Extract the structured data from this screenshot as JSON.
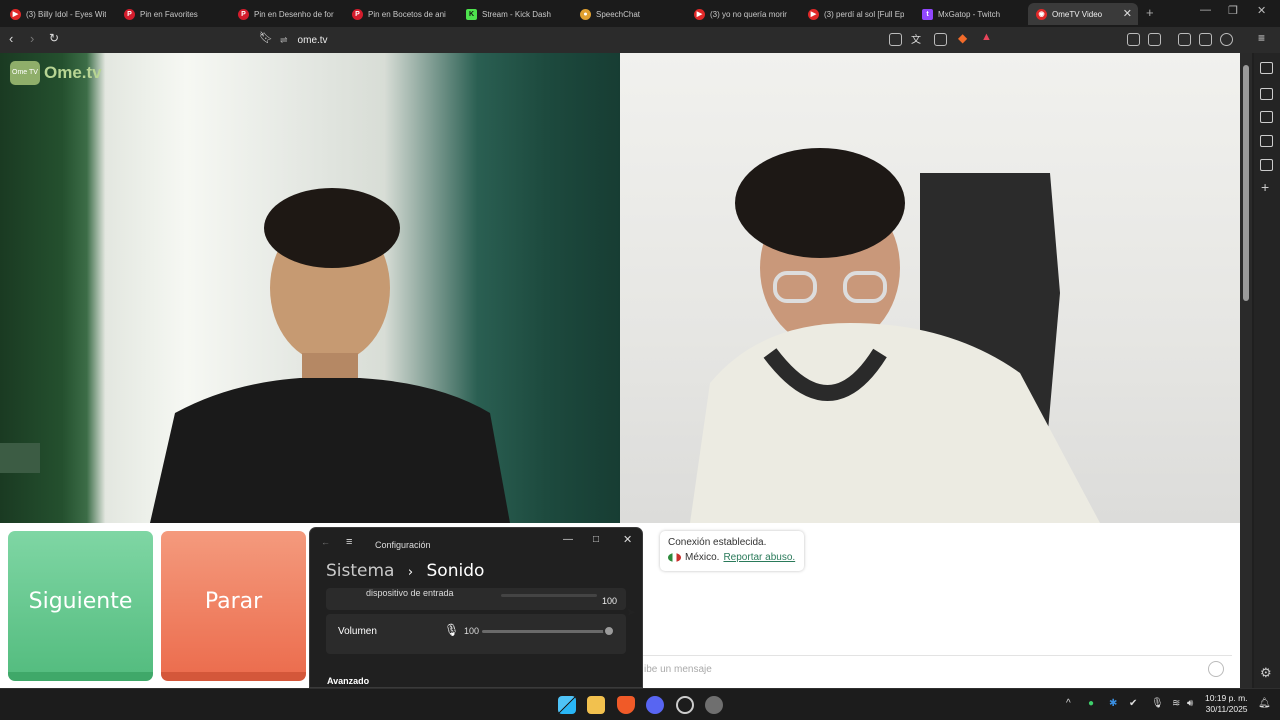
{
  "tabs": [
    {
      "title": "(3) Billy Idol - Eyes Wit",
      "icon": "youtube-icon",
      "color": "#e02828"
    },
    {
      "title": "Pin en Favorites",
      "icon": "pinterest-icon",
      "color": "#d41c2c"
    },
    {
      "title": "Pin en Desenho de for",
      "icon": "pinterest-icon",
      "color": "#d41c2c"
    },
    {
      "title": "Pin en Bocetos de ani",
      "icon": "pinterest-icon",
      "color": "#d41c2c"
    },
    {
      "title": "Stream - Kick Dash",
      "icon": "kick-icon",
      "color": "#4ee34e"
    },
    {
      "title": "SpeechChat",
      "icon": "speechchat-icon",
      "color": "#e0a030"
    },
    {
      "title": "(3) yo no quería morir",
      "icon": "youtube-icon",
      "color": "#e02828"
    },
    {
      "title": "(3) perdí al sol [Full Ep",
      "icon": "youtube-icon",
      "color": "#e02828"
    },
    {
      "title": "MxGatop - Twitch",
      "icon": "twitch-icon",
      "color": "#9147ff"
    },
    {
      "title": "OmeTV Video",
      "icon": "ometv-icon",
      "color": "#e02828",
      "active": true
    }
  ],
  "address": {
    "url": "ome.tv"
  },
  "site": {
    "logo_badge": "Ome TV",
    "logo_word": "Ome.tv",
    "next_label": "Siguiente",
    "stop_label": "Parar",
    "status_line1": "Conexión establecida.",
    "status_country": "México.",
    "status_report": "Reportar abuso.",
    "chat_placeholder": "ibe un mensaje"
  },
  "settings": {
    "window_title": "Configuración",
    "breadcrumb_parent": "Sistema",
    "breadcrumb_sep": "›",
    "breadcrumb_current": "Sonido",
    "input_device_label": "dispositivo de entrada",
    "input_device_value": "100",
    "volume_label": "Volumen",
    "volume_value": "100",
    "volume_level": 1.0,
    "advanced_label": "Avanzado"
  },
  "taskbar": {
    "time": "10:19 p. m.",
    "date": "30/11/2025"
  },
  "colors": {
    "next_button": "#55bd80",
    "stop_button": "#ec6e4f",
    "brand_green": "#8fae6a"
  }
}
